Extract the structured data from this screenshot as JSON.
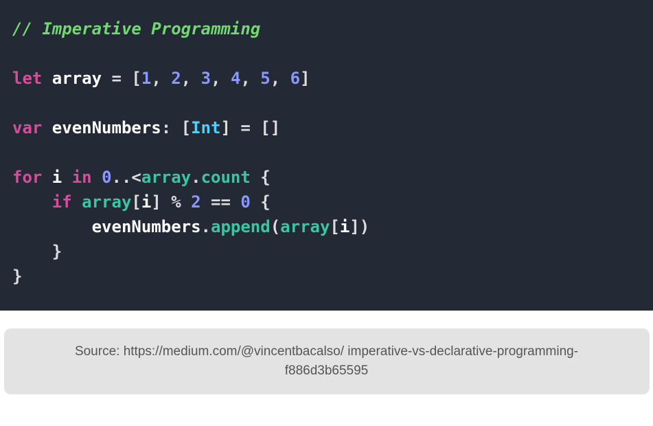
{
  "code": {
    "lines": [
      {
        "type": "comment",
        "text": "// Imperative Programming"
      },
      {
        "type": "blank"
      },
      {
        "type": "tokens",
        "tokens": [
          {
            "cls": "keyword",
            "t": "let "
          },
          {
            "cls": "ident",
            "t": "array "
          },
          {
            "cls": "punct",
            "t": "= ["
          },
          {
            "cls": "number",
            "t": "1"
          },
          {
            "cls": "punct",
            "t": ", "
          },
          {
            "cls": "number",
            "t": "2"
          },
          {
            "cls": "punct",
            "t": ", "
          },
          {
            "cls": "number",
            "t": "3"
          },
          {
            "cls": "punct",
            "t": ", "
          },
          {
            "cls": "number",
            "t": "4"
          },
          {
            "cls": "punct",
            "t": ", "
          },
          {
            "cls": "number",
            "t": "5"
          },
          {
            "cls": "punct",
            "t": ", "
          },
          {
            "cls": "number",
            "t": "6"
          },
          {
            "cls": "punct",
            "t": "]"
          }
        ]
      },
      {
        "type": "blank"
      },
      {
        "type": "tokens",
        "tokens": [
          {
            "cls": "keyword",
            "t": "var "
          },
          {
            "cls": "ident",
            "t": "evenNumbers"
          },
          {
            "cls": "punct",
            "t": ": ["
          },
          {
            "cls": "type",
            "t": "Int"
          },
          {
            "cls": "punct",
            "t": "] = []"
          }
        ]
      },
      {
        "type": "blank"
      },
      {
        "type": "tokens",
        "tokens": [
          {
            "cls": "keyword",
            "t": "for "
          },
          {
            "cls": "ident",
            "t": "i "
          },
          {
            "cls": "keyword",
            "t": "in "
          },
          {
            "cls": "number",
            "t": "0"
          },
          {
            "cls": "punct",
            "t": "..<"
          },
          {
            "cls": "ident-arr",
            "t": "array"
          },
          {
            "cls": "punct",
            "t": "."
          },
          {
            "cls": "member",
            "t": "count "
          },
          {
            "cls": "punct",
            "t": "{"
          }
        ]
      },
      {
        "type": "tokens",
        "indent": 1,
        "tokens": [
          {
            "cls": "keyword",
            "t": "if "
          },
          {
            "cls": "ident-arr",
            "t": "array"
          },
          {
            "cls": "punct",
            "t": "["
          },
          {
            "cls": "ident",
            "t": "i"
          },
          {
            "cls": "punct",
            "t": "] % "
          },
          {
            "cls": "number",
            "t": "2 "
          },
          {
            "cls": "punct",
            "t": "== "
          },
          {
            "cls": "number",
            "t": "0 "
          },
          {
            "cls": "punct",
            "t": "{"
          }
        ]
      },
      {
        "type": "tokens",
        "indent": 2,
        "tokens": [
          {
            "cls": "ident",
            "t": "evenNumbers"
          },
          {
            "cls": "punct",
            "t": "."
          },
          {
            "cls": "member",
            "t": "append"
          },
          {
            "cls": "punct",
            "t": "("
          },
          {
            "cls": "ident-arr",
            "t": "array"
          },
          {
            "cls": "punct",
            "t": "["
          },
          {
            "cls": "ident",
            "t": "i"
          },
          {
            "cls": "punct",
            "t": "])"
          }
        ]
      },
      {
        "type": "tokens",
        "indent": 1,
        "tokens": [
          {
            "cls": "punct",
            "t": "}"
          }
        ]
      },
      {
        "type": "tokens",
        "tokens": [
          {
            "cls": "punct",
            "t": "}"
          }
        ]
      }
    ]
  },
  "caption": "Source: https://medium.com/@vincentbacalso/\nimperative-vs-declarative-programming-f886d3b65595"
}
